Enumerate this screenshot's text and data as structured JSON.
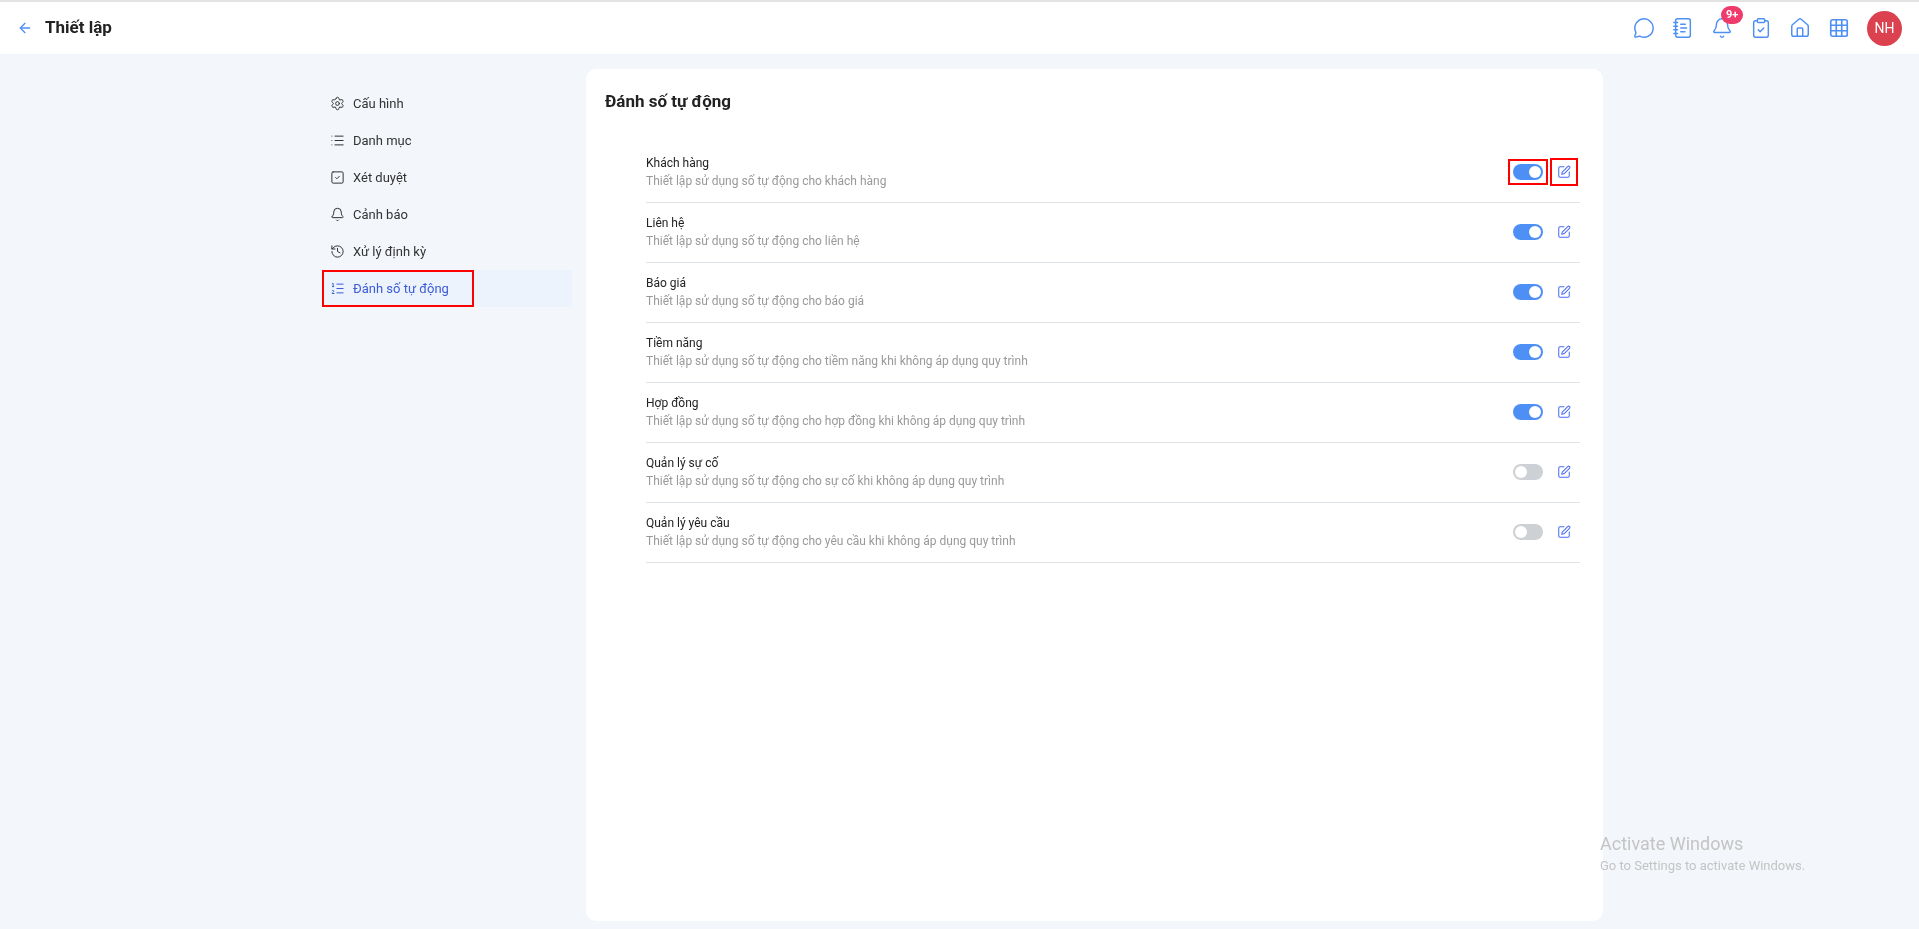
{
  "header": {
    "title": "Thiết lập",
    "notification_badge": "9+",
    "avatar_initials": "NH"
  },
  "sidebar": {
    "items": [
      {
        "label": "Cấu hình",
        "selected": false,
        "highlighted": false
      },
      {
        "label": "Danh mục",
        "selected": false,
        "highlighted": false
      },
      {
        "label": "Xét duyệt",
        "selected": false,
        "highlighted": false
      },
      {
        "label": "Cảnh báo",
        "selected": false,
        "highlighted": false
      },
      {
        "label": "Xử lý định kỳ",
        "selected": false,
        "highlighted": false
      },
      {
        "label": "Đánh số tự động",
        "selected": true,
        "highlighted": true
      }
    ]
  },
  "panel": {
    "title": "Đánh số tự động",
    "rows": [
      {
        "name": "Khách hàng",
        "description": "Thiết lập sử dụng số tự động cho khách hàng",
        "on": true,
        "highlighted": true
      },
      {
        "name": "Liên hệ",
        "description": "Thiết lập sử dụng số tự động cho liên hệ",
        "on": true,
        "highlighted": false
      },
      {
        "name": "Báo giá",
        "description": "Thiết lập sử dụng số tự động cho báo giá",
        "on": true,
        "highlighted": false
      },
      {
        "name": "Tiềm năng",
        "description": "Thiết lập sử dụng số tự động cho tiềm năng khi không áp dụng quy trình",
        "on": true,
        "highlighted": false
      },
      {
        "name": "Hợp đồng",
        "description": "Thiết lập sử dụng số tự động cho hợp đồng khi không áp dụng quy trình",
        "on": true,
        "highlighted": false
      },
      {
        "name": "Quản lý sự cố",
        "description": "Thiết lập sử dụng số tự động cho sự cố khi không áp dụng quy trình",
        "on": false,
        "highlighted": false
      },
      {
        "name": "Quản lý yêu cầu",
        "description": "Thiết lập sử dụng số tự động cho yêu cầu khi không áp dụng quy trình",
        "on": false,
        "highlighted": false
      }
    ]
  },
  "os_notice": {
    "title": "Activate Windows",
    "subtitle": "Go to Settings to activate Windows."
  }
}
